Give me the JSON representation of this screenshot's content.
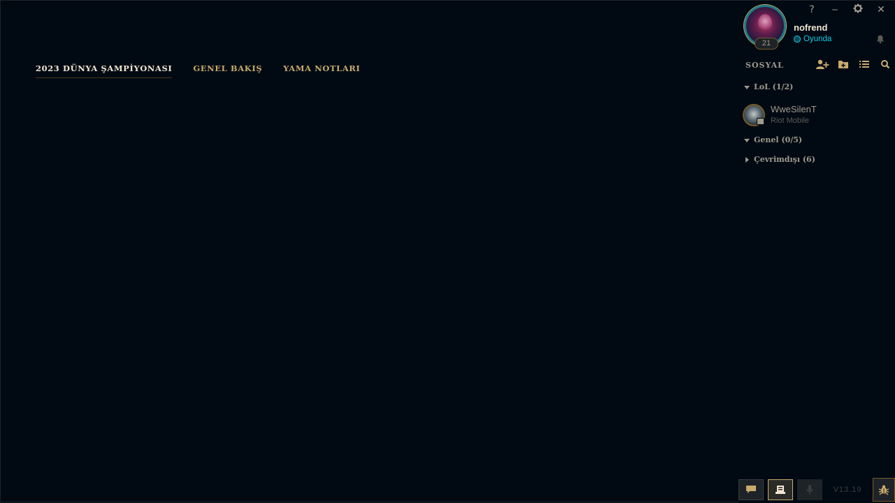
{
  "nav": {
    "tabs": [
      {
        "label": "2023 DÜNYA ŞAMPİYONASI",
        "active": true
      },
      {
        "label": "GENEL BAKIŞ",
        "active": false
      },
      {
        "label": "YAMA NOTLARI",
        "active": false
      }
    ]
  },
  "window_controls": {
    "help": "?",
    "minimize": "‒",
    "settings_icon": "gear-icon",
    "close": "✕"
  },
  "profile": {
    "username": "nofrend",
    "status": "Oyunda",
    "level": "21",
    "status_color": "#0acbe6"
  },
  "social": {
    "title": "SOSYAL",
    "icons": [
      "add-friend-icon",
      "add-folder-icon",
      "list-icon",
      "search-icon"
    ],
    "groups": [
      {
        "label": "LoL (1/2)",
        "expanded": true
      },
      {
        "label": "Genel (0/5)",
        "expanded": true
      },
      {
        "label": "Çevrimdışı (6)",
        "expanded": false
      }
    ],
    "friends": [
      {
        "name": "WweSilenT",
        "status": "Riot Mobile"
      }
    ]
  },
  "bottom_bar": {
    "version": "V13.19",
    "buttons": [
      "chat-icon",
      "missions-icon",
      "mic-icon",
      "bug-icon"
    ]
  },
  "colors": {
    "background": "#010a13",
    "gold": "#c8aa6e",
    "gold_light": "#f0e6d2",
    "grey": "#a09b8c"
  }
}
